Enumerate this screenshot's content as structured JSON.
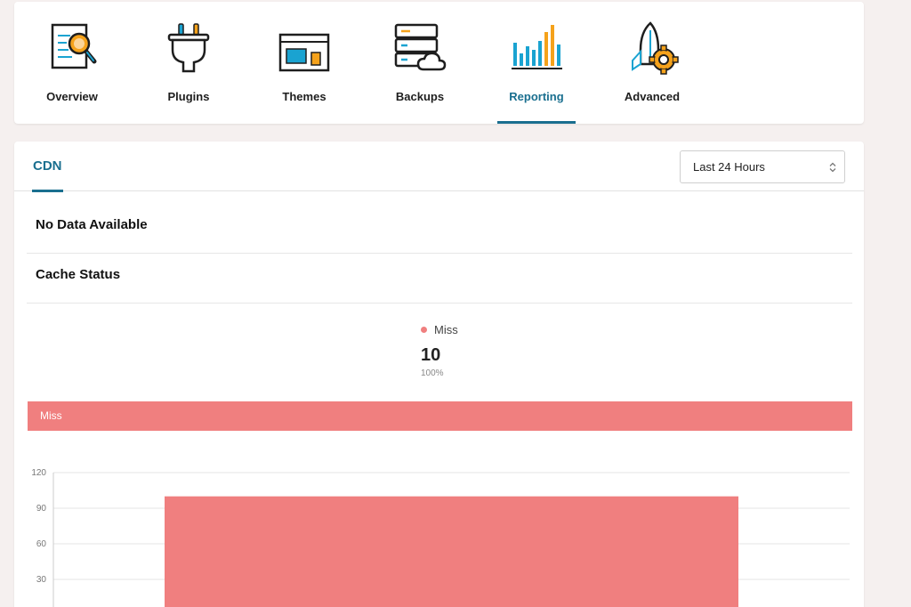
{
  "nav": {
    "items": [
      {
        "id": "overview",
        "label": "Overview",
        "icon": "search-document-icon"
      },
      {
        "id": "plugins",
        "label": "Plugins",
        "icon": "plug-icon"
      },
      {
        "id": "themes",
        "label": "Themes",
        "icon": "layout-icon"
      },
      {
        "id": "backups",
        "label": "Backups",
        "icon": "server-cloud-icon"
      },
      {
        "id": "reporting",
        "label": "Reporting",
        "icon": "bar-chart-icon",
        "active": true
      },
      {
        "id": "advanced",
        "label": "Advanced",
        "icon": "rocket-gear-icon"
      }
    ]
  },
  "tabs": {
    "cdn": "CDN"
  },
  "range_select": {
    "value": "Last 24 Hours"
  },
  "sections": {
    "no_data": "No Data Available",
    "cache_status": "Cache Status"
  },
  "summary": {
    "legend_label": "Miss",
    "value": "10",
    "percent": "100%"
  },
  "miss_bar": {
    "label": "Miss"
  },
  "colors": {
    "accent": "#1a6f8f",
    "miss": "#f07f7f",
    "icon_blue": "#1aa3d1",
    "icon_orange": "#f5a21b"
  },
  "chart_data": {
    "type": "bar",
    "series": [
      {
        "name": "Miss",
        "values": [
          100
        ]
      }
    ],
    "categories": [
      ""
    ],
    "yticks": [
      30,
      60,
      90,
      120
    ],
    "ylim": [
      0,
      120
    ],
    "grid": true
  }
}
